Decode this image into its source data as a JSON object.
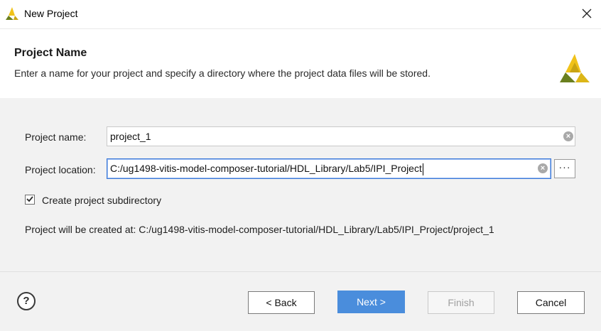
{
  "window": {
    "title": "New Project",
    "close_glyph": "✕"
  },
  "header": {
    "title": "Project Name",
    "description": "Enter a name for your project and specify a directory where the project data files will be stored."
  },
  "form": {
    "project_name_label": "Project name:",
    "project_name_value": "project_1",
    "project_location_label": "Project location:",
    "project_location_value": "C:/ug1498-vitis-model-composer-tutorial/HDL_Library/Lab5/IPI_Project",
    "browse_label": "···",
    "create_subdir_label": "Create project subdirectory",
    "create_subdir_checked": true,
    "created_at_text": "Project will be created at: C:/ug1498-vitis-model-composer-tutorial/HDL_Library/Lab5/IPI_Project/project_1"
  },
  "footer": {
    "help_glyph": "?",
    "back_label": "< Back",
    "next_label": "Next >",
    "finish_label": "Finish",
    "cancel_label": "Cancel"
  },
  "colors": {
    "accent": "#4a8ddc",
    "logo_yellow": "#f0c21a",
    "logo_green": "#6a7f1e",
    "body_bg": "#f2f2f2"
  },
  "icons": {
    "app_logo": "amd-xilinx-logo-icon",
    "close": "close-icon",
    "clear": "clear-icon",
    "help": "help-icon",
    "check": "checkmark-icon"
  }
}
